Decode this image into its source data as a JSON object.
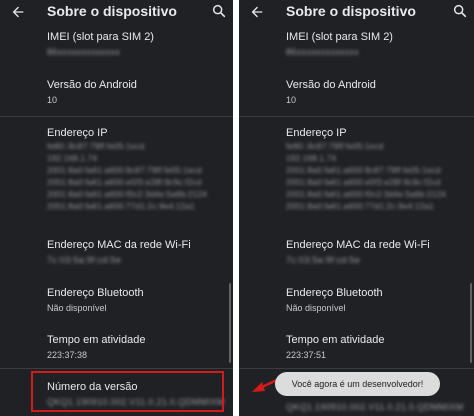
{
  "screen_title": "Sobre o dispositivo",
  "left": {
    "imei_label": "IMEI (slot para SIM 2)",
    "imei_value": "86xxxxxxxxxxxxx",
    "android_label": "Versão do Android",
    "android_value": "10",
    "ip_label": "Endereço IP",
    "ip_lines": [
      "fe80::8c87:79ff:fe05:1ecd",
      "192.168.1.74",
      "2001:8a0:fa61:a600:8c87:79ff:fe05:1ecd",
      "2001:8a0:fa61:a600:e5f3:e28f:9c9c:f2cd",
      "2001:8a0:fa61:a600:f0c2:3d4e:5a6b:2124",
      "2001:8a0:fa61:a600:77d1:2c:9e4:12a1"
    ],
    "mac_label": "Endereço MAC da rede Wi-Fi",
    "mac_value": "7c:03:5a:9f:cd:5e",
    "bt_label": "Endereço Bluetooth",
    "bt_value": "Não disponível",
    "uptime_label": "Tempo em atividade",
    "uptime_value": "223:37:38",
    "build_label": "Número da versão",
    "build_value": "QKQ1.190910.002.V11.0.21.0.QDMMIXM"
  },
  "right": {
    "imei_label": "IMEI (slot para SIM 2)",
    "imei_value": "86xxxxxxxxxxxxx",
    "android_label": "Versão do Android",
    "android_value": "10",
    "ip_label": "Endereço IP",
    "ip_lines": [
      "fe80::8c87:79ff:fe05:1ecd",
      "192.168.1.74",
      "2001:8a0:fa61:a600:8c87:79ff:fe05:1ecd",
      "2001:8a0:fa61:a600:e5f3:e28f:9c9c:f2cd",
      "2001:8a0:fa61:a600:f0c2:3d4e:5a6b:2124",
      "2001:8a0:fa61:a600:77d1:2c:9e4:12a1"
    ],
    "mac_label": "Endereço MAC da rede Wi-Fi",
    "mac_value": "7c:03:5a:9f:cd:5e",
    "bt_label": "Endereço Bluetooth",
    "bt_value": "Não disponível",
    "uptime_label": "Tempo em atividade",
    "uptime_value": "223:37:51",
    "build_value": "QKQ1.190910.002.V11.0.21.0.QDMMIXM"
  },
  "toast": "Você agora é um desenvolvedor!",
  "colors": {
    "background": "#1f2125",
    "highlight": "#d21b1b",
    "arrow": "#d21b1b",
    "toast_bg": "#dcdcdc"
  },
  "icons": [
    "back-arrow-icon",
    "search-icon"
  ]
}
